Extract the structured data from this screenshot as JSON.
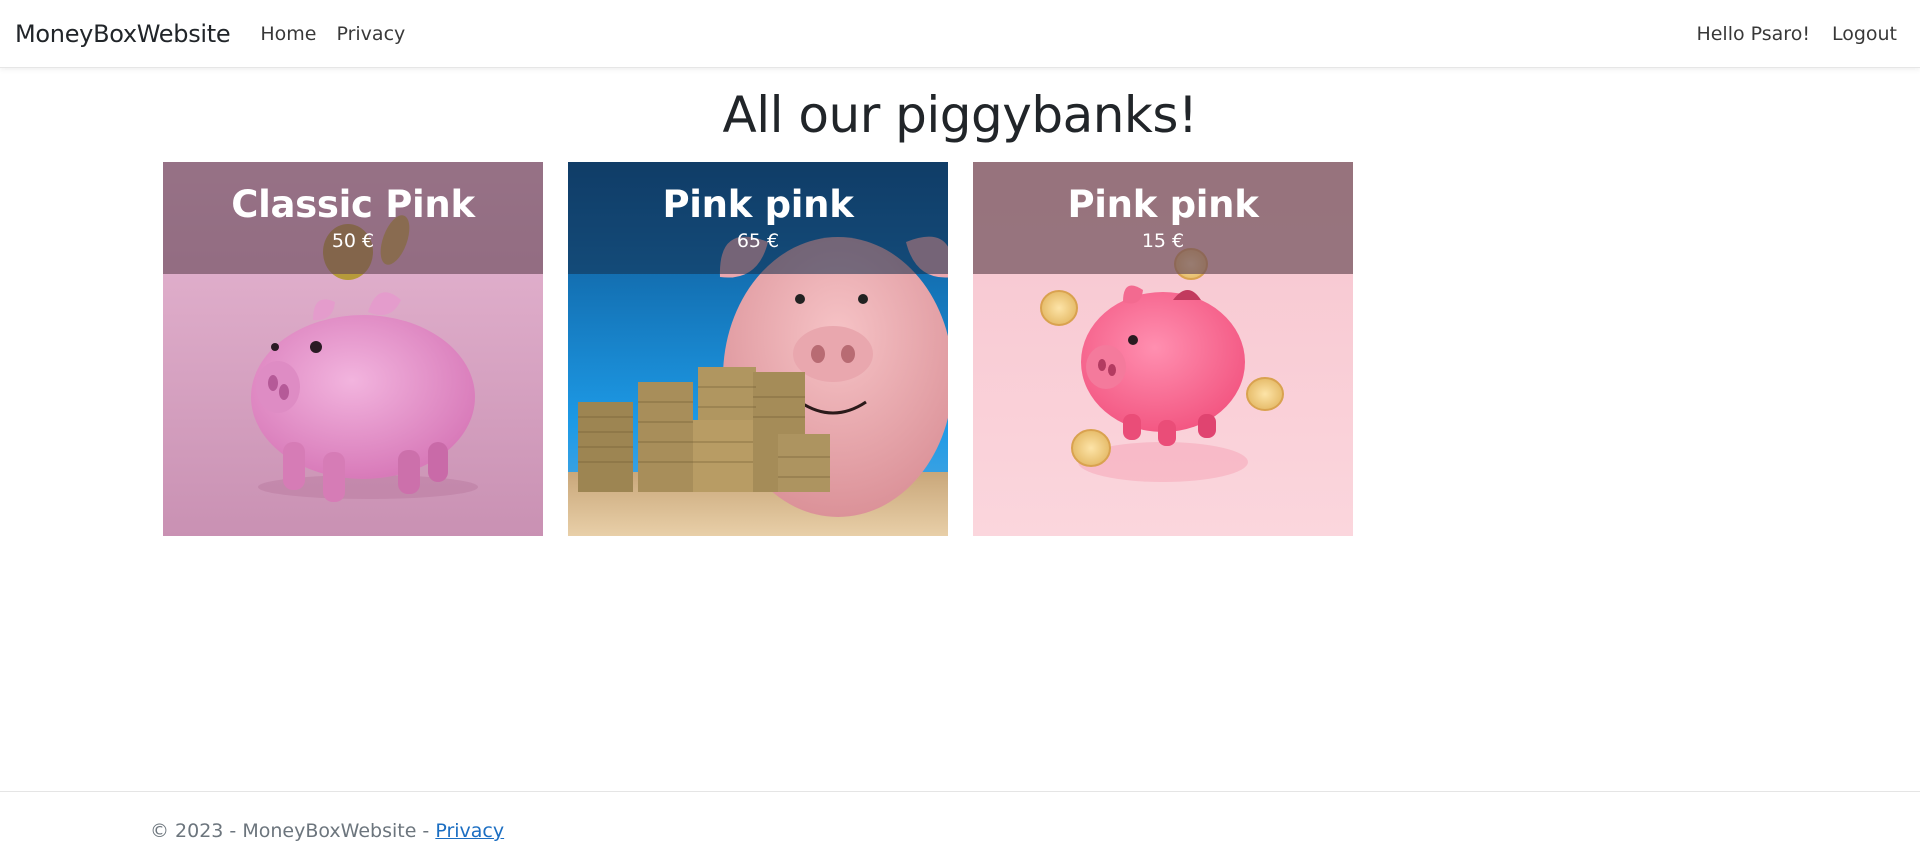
{
  "navbar": {
    "brand": "MoneyBoxWebsite",
    "links": [
      {
        "label": "Home"
      },
      {
        "label": "Privacy"
      }
    ],
    "greeting": "Hello Psaro!",
    "logout": "Logout"
  },
  "main": {
    "title": "All our piggybanks!",
    "cards": [
      {
        "name": "Classic Pink",
        "price": "50 €",
        "image": "pink-piggybank-photo"
      },
      {
        "name": "Pink pink",
        "price": "65 €",
        "image": "piggybank-with-coin-stacks-photo"
      },
      {
        "name": "Pink pink",
        "price": "15 €",
        "image": "flying-piggybank-with-coins-photo"
      }
    ]
  },
  "footer": {
    "copyright": "© 2023 - MoneyBoxWebsite - ",
    "privacy_link": "Privacy"
  },
  "colors": {
    "link": "#1b6ec2",
    "text": "#212529",
    "muted": "#6c757d"
  }
}
